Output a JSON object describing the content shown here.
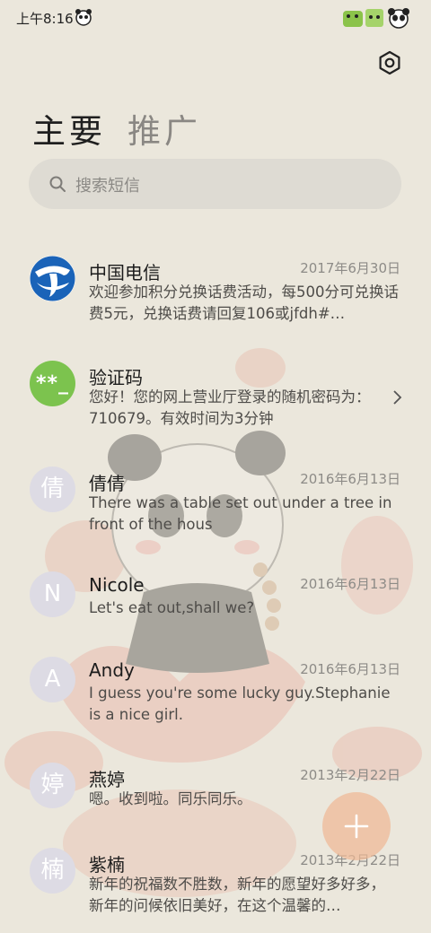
{
  "status_bar": {
    "time": "上午8:16"
  },
  "header": {
    "tabs": [
      {
        "label": "主要",
        "active": true
      },
      {
        "label": "推广",
        "active": false
      }
    ]
  },
  "search": {
    "placeholder": "搜索短信"
  },
  "conversations": [
    {
      "avatar_text": "",
      "avatar_type": "telecom-logo",
      "name": "中国电信",
      "date": "2017年6月30日",
      "preview": "欢迎参加积分兑换话费活动，每500分可兑换话费5元，兑换话费请回复106或jfdh#…"
    },
    {
      "avatar_text": "**_",
      "avatar_type": "green",
      "name": "验证码",
      "date": "",
      "preview": "您好！您的网上营业厅登录的随机密码为：710679。有效时间为3分钟"
    },
    {
      "avatar_text": "倩",
      "avatar_type": "letter",
      "name": "倩倩",
      "date": "2016年6月13日",
      "preview": "There was a table set out under a tree in front of the hous"
    },
    {
      "avatar_text": "N",
      "avatar_type": "letter",
      "name": "Nicole",
      "date": "2016年6月13日",
      "preview": "Let's eat out,shall we?"
    },
    {
      "avatar_text": "A",
      "avatar_type": "letter",
      "name": "Andy",
      "date": "2016年6月13日",
      "preview": "I guess you're some lucky guy.Stephanie is a nice girl."
    },
    {
      "avatar_text": "婷",
      "avatar_type": "letter",
      "name": "燕婷",
      "date": "2013年2月22日",
      "preview": "嗯。收到啦。同乐同乐。"
    },
    {
      "avatar_text": "楠",
      "avatar_type": "letter",
      "name": "紫楠",
      "date": "2013年2月22日",
      "preview": "新年的祝福数不胜数，新年的愿望好多好多，新年的问候依旧美好，在这个温馨的…"
    }
  ],
  "colors": {
    "background": "#ebe7dc",
    "search_bg": "#dedbd3",
    "avatar_default": "#dddbe4",
    "avatar_green": "#7cc34e",
    "telecom_blue": "#1a63b8",
    "fab": "#eeb896"
  },
  "icons": {
    "settings": "gear-hexagon-icon",
    "search": "search-icon",
    "chevron": "chevron-right-icon",
    "compose": "plus-icon"
  }
}
